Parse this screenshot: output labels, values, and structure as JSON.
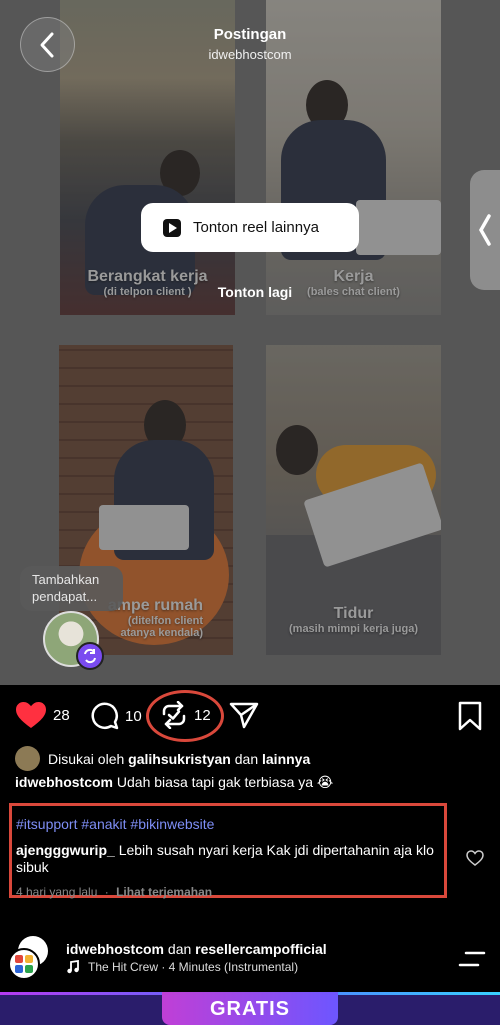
{
  "header": {
    "title": "Postingan",
    "subtitle": "idwebhostcom"
  },
  "reel": {
    "panels": [
      {
        "title": "Berangkat kerja",
        "subtitle": "(di telpon client )"
      },
      {
        "title": "Kerja",
        "subtitle": "(bales chat client)"
      },
      {
        "title": "ampe rumah",
        "subtitle_1": "(ditelfon client",
        "subtitle_2": "atanya kendala)"
      },
      {
        "title": "Tidur",
        "subtitle": "(masih mimpi kerja juga)"
      }
    ],
    "watch_more_label": "Tonton reel lainnya",
    "watch_again_label": "Tonton lagi",
    "comment_prompt": "Tambahkan pendapat..."
  },
  "actions": {
    "likes": "28",
    "comments": "10",
    "reposts": "12"
  },
  "post": {
    "liked_prefix": "Disukai oleh ",
    "liked_user": "galihsukristyan",
    "liked_mid": " dan ",
    "liked_others": "lainnya",
    "author": "idwebhostcom",
    "caption": "Udah biasa tapi gak terbiasa ya 😭",
    "hashtags": "#itsupport #anakit #bikinwebsite",
    "top_comment_user": "ajengggwurip_",
    "top_comment_text": "Lebih susah nyari kerja Kak jdi dipertahanin aja klo sibuk",
    "comment_time": "4 hari yang lalu",
    "comment_translate": "Lihat terjemahan"
  },
  "music": {
    "author_1": "idwebhostcom",
    "joiner": " dan ",
    "author_2": "resellercampofficial",
    "track": "The Hit Crew · 4 Minutes (Instrumental)"
  },
  "banner": {
    "label": "GRATIS"
  },
  "colors": {
    "like_red": "#ff3040",
    "highlight_red": "#d9483b",
    "hashtag_blue": "#7e8ef5"
  }
}
